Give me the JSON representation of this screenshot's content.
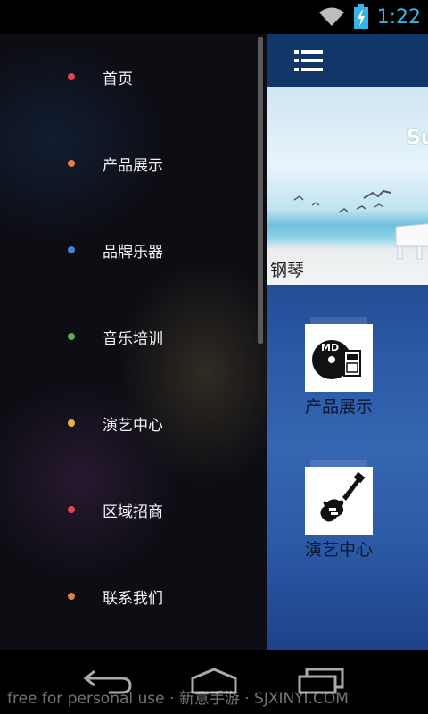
{
  "status_bar": {
    "time": "1:22",
    "icons": [
      "wifi-icon",
      "battery-charging-icon"
    ],
    "time_color": "#35b5e5"
  },
  "drawer": {
    "items": [
      {
        "label": "首页",
        "dot_color": "#e0474c"
      },
      {
        "label": "产品展示",
        "dot_color": "#e0804c"
      },
      {
        "label": "品牌乐器",
        "dot_color": "#4a7fd6"
      },
      {
        "label": "音乐培训",
        "dot_color": "#5bb04c"
      },
      {
        "label": "演艺中心",
        "dot_color": "#e0b44c"
      },
      {
        "label": "区域招商",
        "dot_color": "#e0474c"
      },
      {
        "label": "联系我们",
        "dot_color": "#e0804c"
      }
    ]
  },
  "main": {
    "menu_icon": "hamburger-list-icon",
    "banner": {
      "logo_text": "Su",
      "caption": "钢琴"
    },
    "tiles": [
      {
        "label": "产品展示",
        "icon": "md-disc-icon"
      },
      {
        "label": "演艺中心",
        "icon": "electric-guitar-icon"
      }
    ]
  },
  "nav_bar": {
    "buttons": [
      "back-icon",
      "home-icon",
      "recent-apps-icon"
    ]
  },
  "watermark": {
    "text": "free for personal use · 新意手游 · SJXINYI.COM"
  }
}
